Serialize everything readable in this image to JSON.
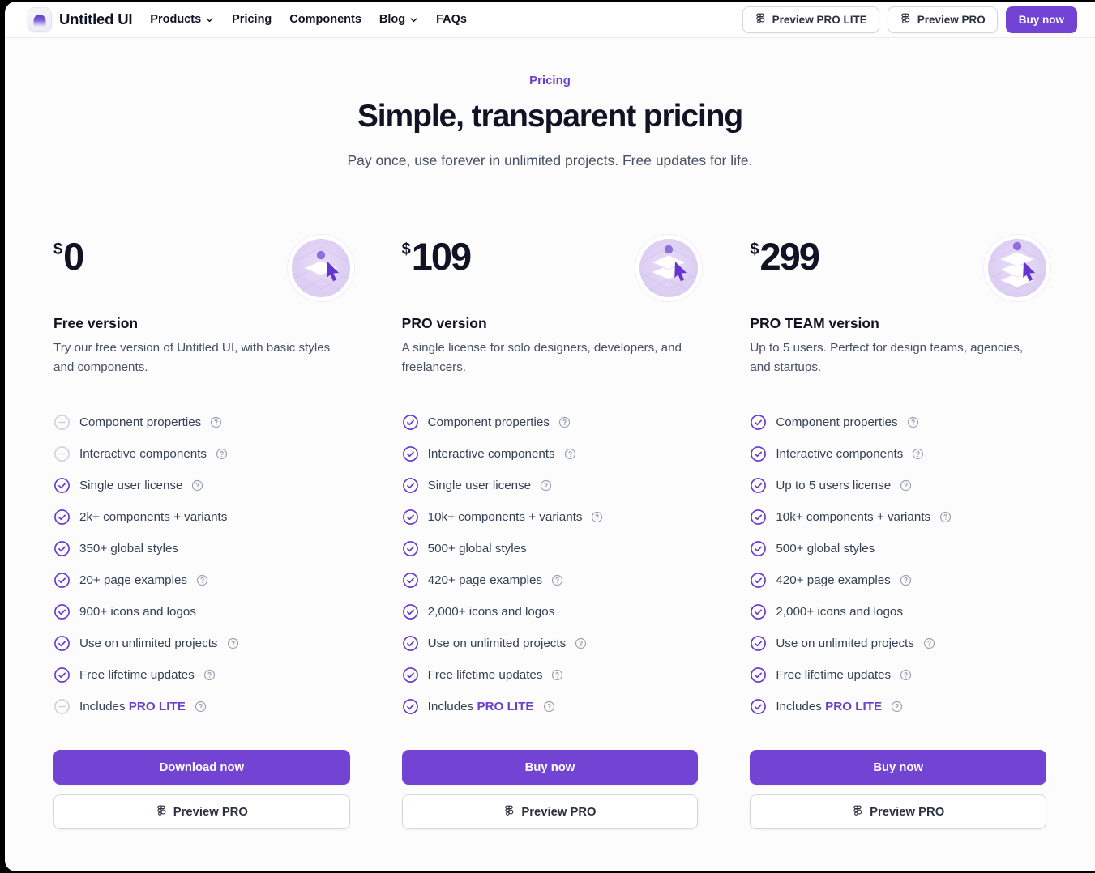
{
  "theme": {
    "accent": "#7344d4",
    "accent_text": "#6941c6",
    "heading": "#101323",
    "body_text": "#475065",
    "page_bg": "#fcfcfd"
  },
  "header": {
    "brand": "Untitled UI",
    "logo_icon": "untitled-ui-logo",
    "nav": [
      {
        "label": "Products",
        "has_chevron": true
      },
      {
        "label": "Pricing",
        "has_chevron": false
      },
      {
        "label": "Components",
        "has_chevron": false
      },
      {
        "label": "Blog",
        "has_chevron": true
      },
      {
        "label": "FAQs",
        "has_chevron": false
      }
    ],
    "actions": [
      {
        "label": "Preview PRO LITE",
        "icon": "figma-icon",
        "style": "ghost"
      },
      {
        "label": "Preview PRO",
        "icon": "figma-icon",
        "style": "ghost"
      },
      {
        "label": "Buy now",
        "icon": null,
        "style": "primary"
      }
    ]
  },
  "hero": {
    "eyebrow": "Pricing",
    "title": "Simple, transparent pricing",
    "subtitle": "Pay once, use forever in unlimited projects. Free updates for life."
  },
  "plans": [
    {
      "currency": "$",
      "price": "0",
      "name": "Free version",
      "description": "Try our free version of Untitled UI, with basic styles and components.",
      "badge_icon": "single-layer-cursor-icon",
      "badge_layers": 1,
      "features": [
        {
          "text": "Component properties",
          "included": false,
          "help": true
        },
        {
          "text": "Interactive components",
          "included": false,
          "help": true
        },
        {
          "text": "Single user license",
          "included": true,
          "help": true
        },
        {
          "text": "2k+ components + variants",
          "included": true,
          "help": false
        },
        {
          "text": "350+ global styles",
          "included": true,
          "help": false
        },
        {
          "text": "20+ page examples",
          "included": true,
          "help": true
        },
        {
          "text": "900+ icons and logos",
          "included": true,
          "help": false
        },
        {
          "text": "Use on unlimited projects",
          "included": true,
          "help": true
        },
        {
          "text": "Free lifetime updates",
          "included": true,
          "help": true
        },
        {
          "text": "Includes ",
          "highlight": "PRO LITE",
          "included": false,
          "help": true
        }
      ],
      "primary_button": "Download now",
      "secondary_button": "Preview PRO"
    },
    {
      "currency": "$",
      "price": "109",
      "name": "PRO version",
      "description": "A single license for solo designers, developers, and freelancers.",
      "badge_icon": "double-layer-cursor-icon",
      "badge_layers": 2,
      "features": [
        {
          "text": "Component properties",
          "included": true,
          "help": true
        },
        {
          "text": "Interactive components",
          "included": true,
          "help": true
        },
        {
          "text": "Single user license",
          "included": true,
          "help": true
        },
        {
          "text": "10k+ components + variants",
          "included": true,
          "help": true
        },
        {
          "text": "500+ global styles",
          "included": true,
          "help": false
        },
        {
          "text": "420+ page examples",
          "included": true,
          "help": true
        },
        {
          "text": "2,000+ icons and logos",
          "included": true,
          "help": false
        },
        {
          "text": "Use on unlimited projects",
          "included": true,
          "help": true
        },
        {
          "text": "Free lifetime updates",
          "included": true,
          "help": true
        },
        {
          "text": "Includes ",
          "highlight": "PRO LITE",
          "included": true,
          "help": true
        }
      ],
      "primary_button": "Buy now",
      "secondary_button": "Preview PRO"
    },
    {
      "currency": "$",
      "price": "299",
      "name": "PRO TEAM version",
      "description": "Up to 5 users. Perfect for design teams, agencies, and startups.",
      "badge_icon": "triple-layer-cursor-icon",
      "badge_layers": 3,
      "features": [
        {
          "text": "Component properties",
          "included": true,
          "help": true
        },
        {
          "text": "Interactive components",
          "included": true,
          "help": true
        },
        {
          "text": "Up to 5 users license",
          "included": true,
          "help": true
        },
        {
          "text": "10k+ components + variants",
          "included": true,
          "help": true
        },
        {
          "text": "500+ global styles",
          "included": true,
          "help": false
        },
        {
          "text": "420+ page examples",
          "included": true,
          "help": true
        },
        {
          "text": "2,000+ icons and logos",
          "included": true,
          "help": false
        },
        {
          "text": "Use on unlimited projects",
          "included": true,
          "help": true
        },
        {
          "text": "Free lifetime updates",
          "included": true,
          "help": true
        },
        {
          "text": "Includes ",
          "highlight": "PRO LITE",
          "included": true,
          "help": true
        }
      ],
      "primary_button": "Buy now",
      "secondary_button": "Preview PRO"
    }
  ]
}
